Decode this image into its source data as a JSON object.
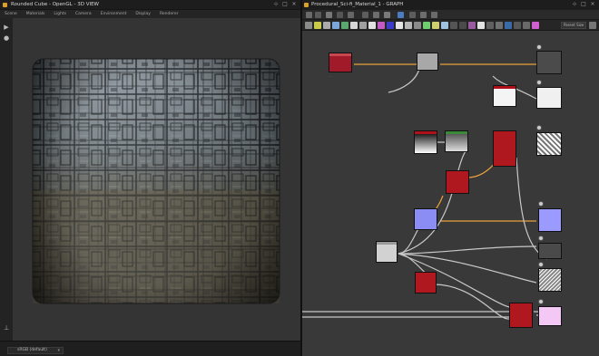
{
  "left_panel": {
    "title": "Rounded Cube - OpenGL - 3D VIEW",
    "menu": [
      "Scene",
      "Materials",
      "Lights",
      "Camera",
      "Environment",
      "Display",
      "Renderer"
    ],
    "environment_select": "sRGB (default)"
  },
  "right_panel": {
    "title": "Procedural_Sci-fi_Material_1 - GRAPH",
    "parent_size_label": "Parent Size"
  },
  "icons": {
    "window_pin": "pin-icon",
    "window_maximize": "maximize-icon",
    "window_close": "close-icon",
    "camera": "camera-icon",
    "light": "light-icon",
    "axes": "axes-icon"
  },
  "colors": {
    "node_red": "#b0101a",
    "node_blue": "#8c8cf5",
    "node_gray": "#d0d0d0",
    "wire_orange": "#e9a23c",
    "wire_gray": "#c8c8c8"
  }
}
